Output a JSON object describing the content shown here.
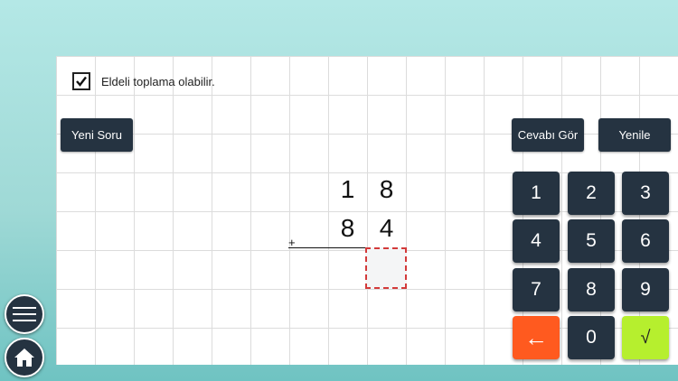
{
  "options": {
    "carry_label": "Eldeli toplama olabilir.",
    "carry_checked": true
  },
  "buttons": {
    "new_question": "Yeni Soru",
    "show_answer": "Cevabı Gör",
    "refresh": "Yenile"
  },
  "problem": {
    "top_tens": "1",
    "top_ones": "8",
    "bottom_tens": "8",
    "bottom_ones": "4",
    "operator": "+",
    "answer": ""
  },
  "keypad": {
    "k1": "1",
    "k2": "2",
    "k3": "3",
    "k4": "4",
    "k5": "5",
    "k6": "6",
    "k7": "7",
    "k8": "8",
    "k9": "9",
    "back": "←",
    "k0": "0",
    "ok": "√"
  },
  "colors": {
    "button_bg": "#253341",
    "backspace_bg": "#ff5a1f",
    "submit_bg": "#b6ef2e",
    "answer_border": "#d33a3a"
  },
  "icons": {
    "menu": "hamburger-menu-icon",
    "home": "home-icon"
  }
}
